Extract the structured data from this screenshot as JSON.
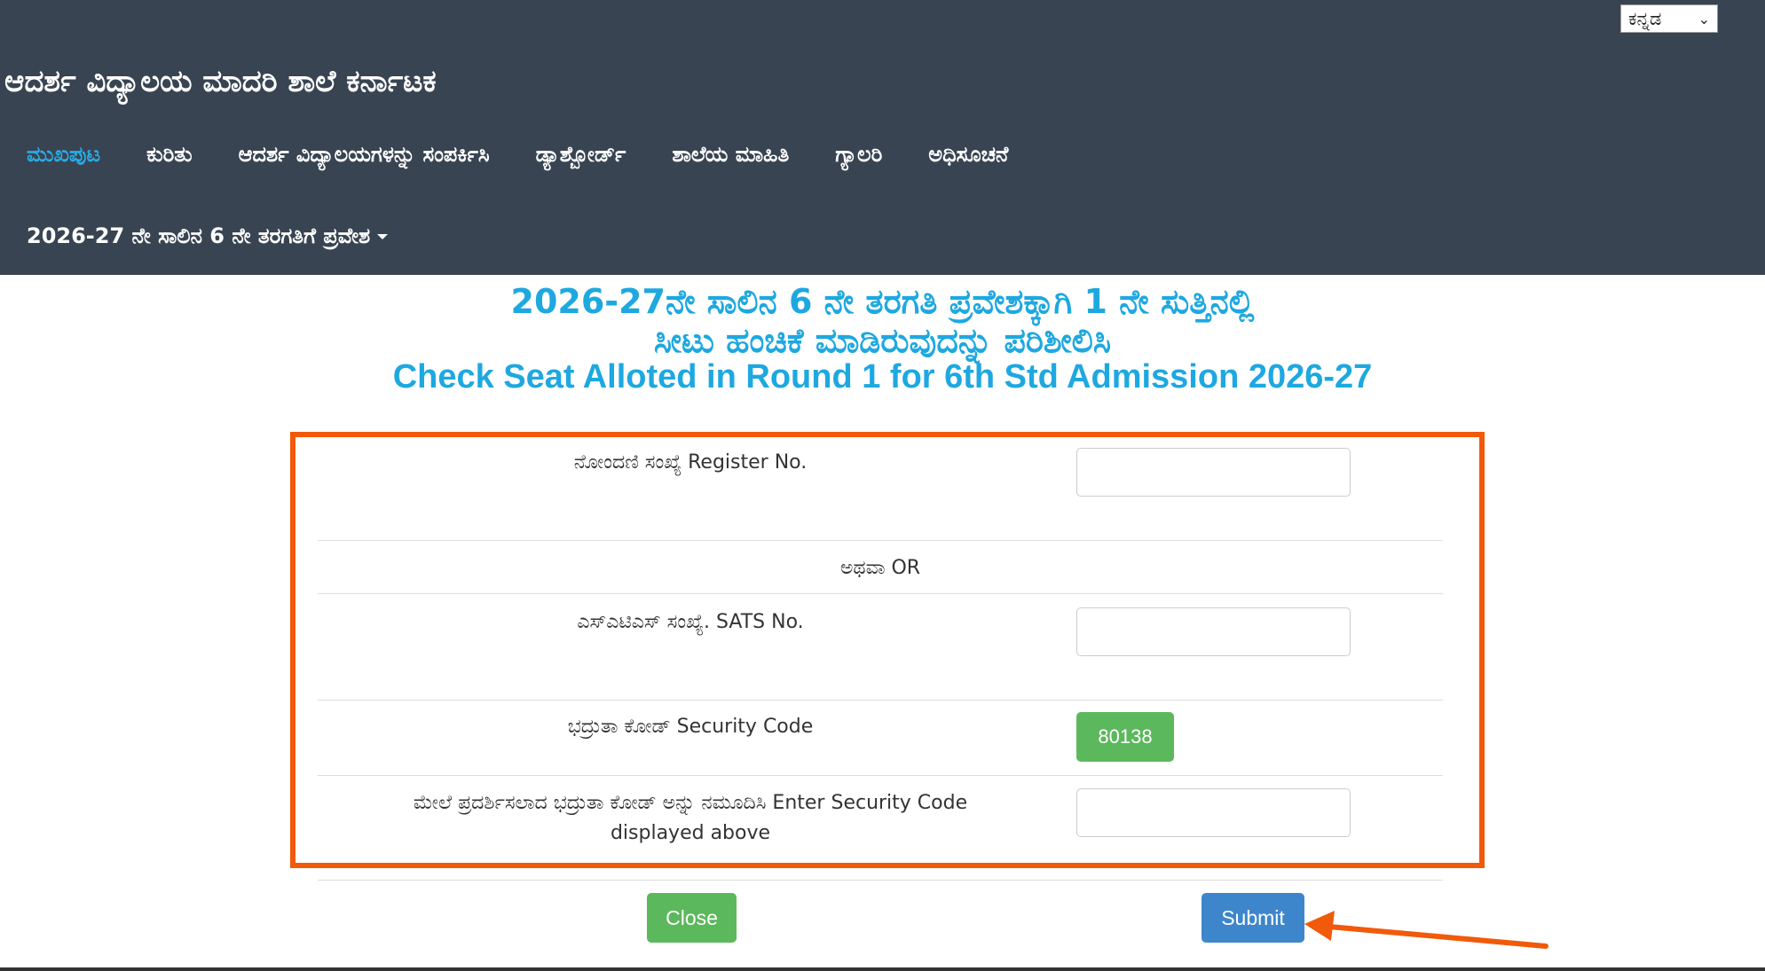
{
  "header": {
    "language_select": "ಕನ್ನಡ",
    "site_title": "ಆದರ್ಶ ವಿದ್ಯಾಲಯ ಮಾದರಿ ಶಾಲೆ ಕರ್ನಾಟಕ",
    "nav": [
      {
        "label": "ಮುಖಪುಟ",
        "active": true
      },
      {
        "label": "ಕುರಿತು",
        "active": false
      },
      {
        "label": "ಆದರ್ಶ ವಿದ್ಯಾಲಯಗಳನ್ನು ಸಂಪರ್ಕಿಸಿ",
        "active": false
      },
      {
        "label": "ಡ್ಯಾಶ್ಬೋರ್ಡ್",
        "active": false
      },
      {
        "label": "ಶಾಲೆಯ ಮಾಹಿತಿ",
        "active": false
      },
      {
        "label": "ಗ್ಯಾಲರಿ",
        "active": false
      },
      {
        "label": "ಅಧಿಸೂಚನೆ",
        "active": false
      }
    ],
    "admission_menu": "2026-27 ನೇ ಸಾಲಿನ 6 ನೇ ತರಗತಿಗೆ ಪ್ರವೇಶ"
  },
  "page": {
    "heading_line1": "2026-27ನೇ ಸಾಲಿನ 6 ನೇ ತರಗತಿ ಪ್ರವೇಶಕ್ಕಾಗಿ 1 ನೇ ಸುತ್ತಿನಲ್ಲಿ",
    "heading_line2": "ಸೀಟು ಹಂಚಿಕೆ ಮಾಡಿರುವುದನ್ನು ಪರಿಶೀಲಿಸಿ",
    "heading_line3": "Check Seat Alloted in Round 1 for 6th Std Admission 2026-27"
  },
  "form": {
    "register_label": "ನೋಂದಣಿ ಸಂಖ್ಯೆ Register No.",
    "register_value": "",
    "or_label": "ಅಥವಾ OR",
    "sats_label": "ಎಸ್ಎಟಿಎಸ್ ಸಂಖ್ಯೆ. SATS No.",
    "sats_value": "",
    "security_label": "ಭದ್ರುತಾ ಕೋಡ್ Security Code",
    "security_code": "80138",
    "enter_code_label_line1": "ಮೇಲೆ ಪ್ರದರ್ಶಿಸಲಾದ ಭದ್ರುತಾ ಕೋಡ್ ಅನ್ನು ನಮೂದಿಸಿ Enter Security Code",
    "enter_code_label_line2": "displayed above",
    "enter_code_value": "",
    "close_button": "Close",
    "submit_button": "Submit"
  },
  "colors": {
    "header_bg": "#394452",
    "active_nav": "#29abe2",
    "heading": "#1ea8e0",
    "highlight_border": "#f05a0a",
    "success_green": "#5cb85c",
    "primary_blue": "#3d86cc"
  }
}
